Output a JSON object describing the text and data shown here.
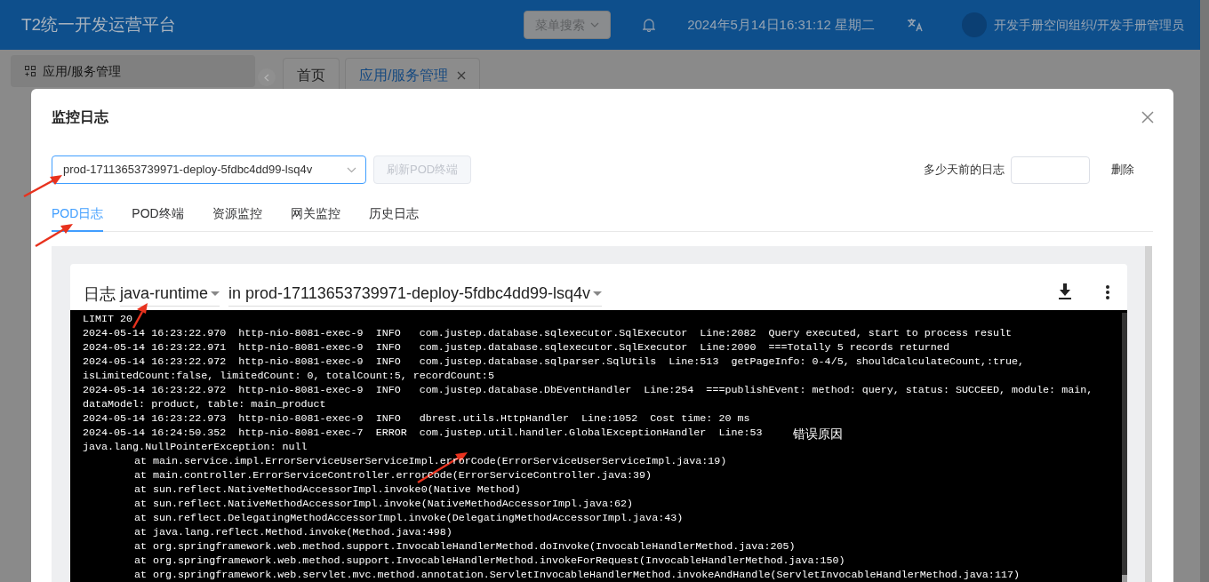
{
  "header": {
    "title": "T2统一开发运营平台",
    "menu_search": {
      "placeholder": "菜单搜索"
    },
    "datetime": "2024年5月14日16:31:12 星期二",
    "user": "开发手册空间组织/开发手册管理员"
  },
  "sidebar": {
    "items": [
      {
        "label": "应用/服务管理",
        "selected": true
      }
    ]
  },
  "page_tabs": [
    {
      "label": "首页",
      "selected": false,
      "closable": false
    },
    {
      "label": "应用/服务管理",
      "selected": true,
      "closable": true
    }
  ],
  "dialog": {
    "title": "监控日志",
    "pod_select": {
      "value": "prod-17113653739971-deploy-5fdbc4dd99-lsq4v"
    },
    "refresh_button": {
      "label": "刷新POD终端",
      "disabled": true
    },
    "days_label": "多少天前的日志",
    "delete_button": "删除",
    "tabs": [
      {
        "label": "POD日志",
        "selected": true
      },
      {
        "label": "POD终端",
        "selected": false
      },
      {
        "label": "资源监控",
        "selected": false
      },
      {
        "label": "网关监控",
        "selected": false
      },
      {
        "label": "历史日志",
        "selected": false
      }
    ],
    "log_panel": {
      "title": "日志",
      "container": "java-runtime",
      "pod_prefix": "in",
      "pod": "prod-17113653739971-deploy-5fdbc4dd99-lsq4v",
      "lines": [
        {
          "kind": "plain",
          "text": "LIMIT 20"
        },
        {
          "kind": "plain",
          "text": "2024-05-14 16:23:22.970  http-nio-8081-exec-9  INFO   com.justep.database.sqlexecutor.SqlExecutor  Line:2082  Query executed, start to process result"
        },
        {
          "kind": "plain",
          "text": "2024-05-14 16:23:22.971  http-nio-8081-exec-9  INFO   com.justep.database.sqlexecutor.SqlExecutor  Line:2090  ===Totally 5 records returned"
        },
        {
          "kind": "plain",
          "text": "2024-05-14 16:23:22.972  http-nio-8081-exec-9  INFO   com.justep.database.sqlparser.SqlUtils  Line:513  getPageInfo: 0-4/5, shouldCalculateCount,:true,"
        },
        {
          "kind": "plain",
          "text": "isLimitedCount:false, limitedCount: 0, totalCount:5, recordCount:5"
        },
        {
          "kind": "plain",
          "text": "2024-05-14 16:23:22.972  http-nio-8081-exec-9  INFO   com.justep.database.DbEventHandler  Line:254  ===publishEvent: method: query, status: SUCCEED, module: main,"
        },
        {
          "kind": "plain",
          "text": "dataModel: product, table: main_product"
        },
        {
          "kind": "plain",
          "text": "2024-05-14 16:23:22.973  http-nio-8081-exec-9  INFO   dbrest.utils.HttpHandler  Line:1052  Cost time: 20 ms"
        },
        {
          "kind": "plain",
          "text": "2024-05-14 16:24:50.352  http-nio-8081-exec-7  ERROR  com.justep.util.handler.GlobalExceptionHandler  Line:53",
          "note": "错误原因"
        },
        {
          "kind": "plain",
          "text": "java.lang.NullPointerException: null"
        },
        {
          "kind": "trace",
          "text": "at main.service.impl.ErrorServiceUserServiceImpl.errorCode(ErrorServiceUserServiceImpl.java:19)"
        },
        {
          "kind": "trace",
          "text": "at main.controller.ErrorServiceController.errorCode(ErrorServiceController.java:39)"
        },
        {
          "kind": "trace",
          "text": "at sun.reflect.NativeMethodAccessorImpl.invoke0(Native Method)"
        },
        {
          "kind": "trace",
          "text": "at sun.reflect.NativeMethodAccessorImpl.invoke(NativeMethodAccessorImpl.java:62)"
        },
        {
          "kind": "trace",
          "text": "at sun.reflect.DelegatingMethodAccessorImpl.invoke(DelegatingMethodAccessorImpl.java:43)"
        },
        {
          "kind": "trace",
          "text": "at java.lang.reflect.Method.invoke(Method.java:498)"
        },
        {
          "kind": "trace",
          "text": "at org.springframework.web.method.support.InvocableHandlerMethod.doInvoke(InvocableHandlerMethod.java:205)"
        },
        {
          "kind": "trace",
          "text": "at org.springframework.web.method.support.InvocableHandlerMethod.invokeForRequest(InvocableHandlerMethod.java:150)"
        },
        {
          "kind": "trace",
          "text": "at org.springframework.web.servlet.mvc.method.annotation.ServletInvocableHandlerMethod.invokeAndHandle(ServletInvocableHandlerMethod.java:117)"
        }
      ]
    }
  }
}
